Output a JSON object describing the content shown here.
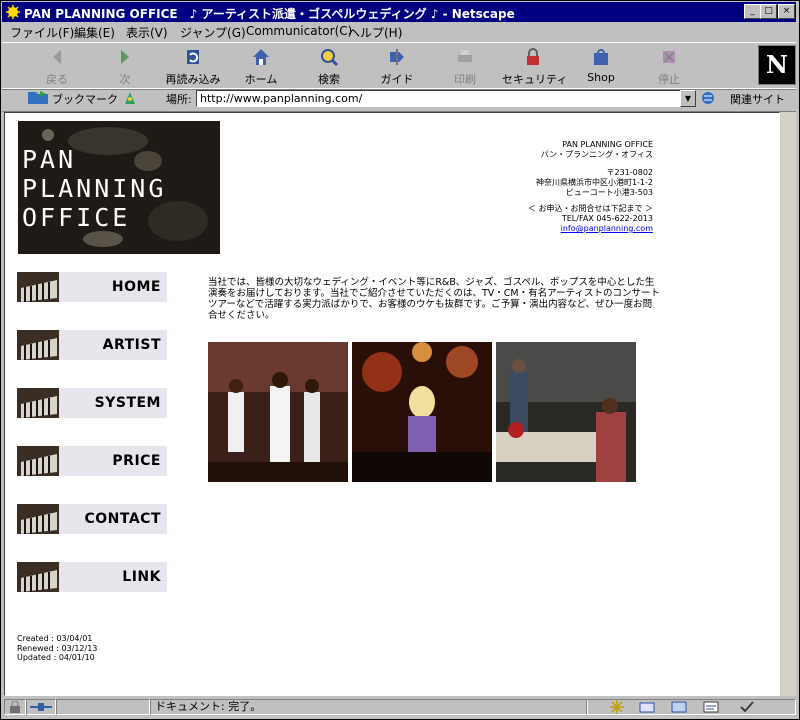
{
  "window": {
    "title": "PAN PLANNING OFFICE　♪ アーティスト派遣・ゴスペルウェディング ♪ - Netscape",
    "controls": [
      "_",
      "□",
      "×"
    ]
  },
  "menu": [
    "ファイル(F)",
    "編集(E)",
    "表示(V)",
    "ジャンプ(G)",
    "Communicator(C)",
    "ヘルプ(H)"
  ],
  "toolbar": [
    {
      "label": "戻る",
      "icon": "back-arrow-icon",
      "enabled": false
    },
    {
      "label": "次",
      "icon": "forward-arrow-icon",
      "enabled": false
    },
    {
      "label": "再読み込み",
      "icon": "reload-icon",
      "enabled": true
    },
    {
      "label": "ホーム",
      "icon": "home-icon",
      "enabled": true
    },
    {
      "label": "検索",
      "icon": "search-icon",
      "enabled": true
    },
    {
      "label": "ガイド",
      "icon": "guide-icon",
      "enabled": true
    },
    {
      "label": "印刷",
      "icon": "print-icon",
      "enabled": false
    },
    {
      "label": "セキュリティ",
      "icon": "security-lock-icon",
      "enabled": true
    },
    {
      "label": "Shop",
      "icon": "shop-bag-icon",
      "enabled": true
    },
    {
      "label": "停止",
      "icon": "stop-icon",
      "enabled": false
    }
  ],
  "brand_logo": "N",
  "location": {
    "bookmarks_label": "ブックマーク",
    "location_label": "場所:",
    "url": "http://www.panplanning.com/",
    "related_label": "関連サイト"
  },
  "page": {
    "logo_text": "PAN\nPLANNING\nOFFICE",
    "address": {
      "company_en": "PAN PLANNING OFFICE",
      "company_ja": "パン・プランニング・オフィス",
      "postal": "〒231-0802",
      "street": "神奈川県横浜市中区小港町1-1-2",
      "building": "ビューコート小港3-503",
      "inquiry": "＜ お申込・お問合せは下記まで ＞",
      "tel": "TEL/FAX 045-622-2013",
      "email": "info@panplanning.com"
    },
    "nav": [
      "HOME",
      "ARTIST",
      "SYSTEM",
      "PRICE",
      "CONTACT",
      "LINK"
    ],
    "intro": "当社では、皆様の大切なウェディング・イベント等にR&B、ジャズ、ゴスペル、ポップスを中心とした生演奏をお届けしております。当社でご紹介させていただくのは、TV・CM・有名アーティストのコンサートツアーなどで活躍する実力派ばかりで、お客様のウケも抜群です。ご予算・演出内容など、ぜひ一度お問合せください。",
    "dates": "Created : 03/04/01\nRenewed : 03/12/13\nUpdated : 04/01/10"
  },
  "status": {
    "text": "ドキュメント: 完了。"
  },
  "colors": {
    "titlebar": "#000080",
    "chrome": "#c0c0c0",
    "link": "#0000ee"
  }
}
